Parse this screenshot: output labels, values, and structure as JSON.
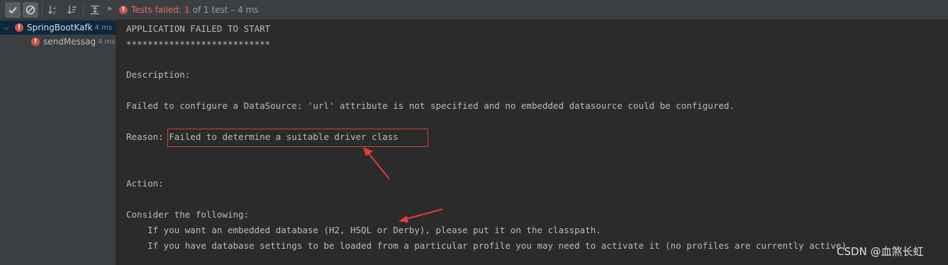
{
  "toolbar": {
    "buttons": [
      {
        "icon": "checkmark-icon",
        "active": true
      },
      {
        "icon": "cancel-circle-icon",
        "active": true
      },
      {
        "icon": "sort-alpha-icon",
        "active": false
      },
      {
        "icon": "sort-duration-icon",
        "active": false
      },
      {
        "icon": "expand-all-icon",
        "active": false
      }
    ],
    "more": "»",
    "status_failed": "Tests failed:",
    "status_count": "1",
    "status_rest": "of 1 test – 4 ms",
    "error_color": "#c75450"
  },
  "tree": {
    "items": [
      {
        "name": "SpringBootKafk",
        "time": "4 ms",
        "expanded": true,
        "selected": true
      },
      {
        "name": "sendMessag",
        "time": "4 ms",
        "selected": false
      }
    ]
  },
  "console": {
    "lines": [
      "APPLICATION FAILED TO START",
      "***************************",
      "Description:",
      "Failed to configure a DataSource: 'url' attribute is not specified and no embedded datasource could be configured.",
      "Reason: Failed to determine a suitable driver class",
      "Action:",
      "Consider the following:",
      "    If you want an embedded database (H2, HSQL or Derby), please put it on the classpath.",
      "    If you have database settings to be loaded from a particular profile you may need to activate it (no profiles are currently active)."
    ]
  },
  "annotation_color": "#e03c3c",
  "watermark": "CSDN @血煞长虹"
}
